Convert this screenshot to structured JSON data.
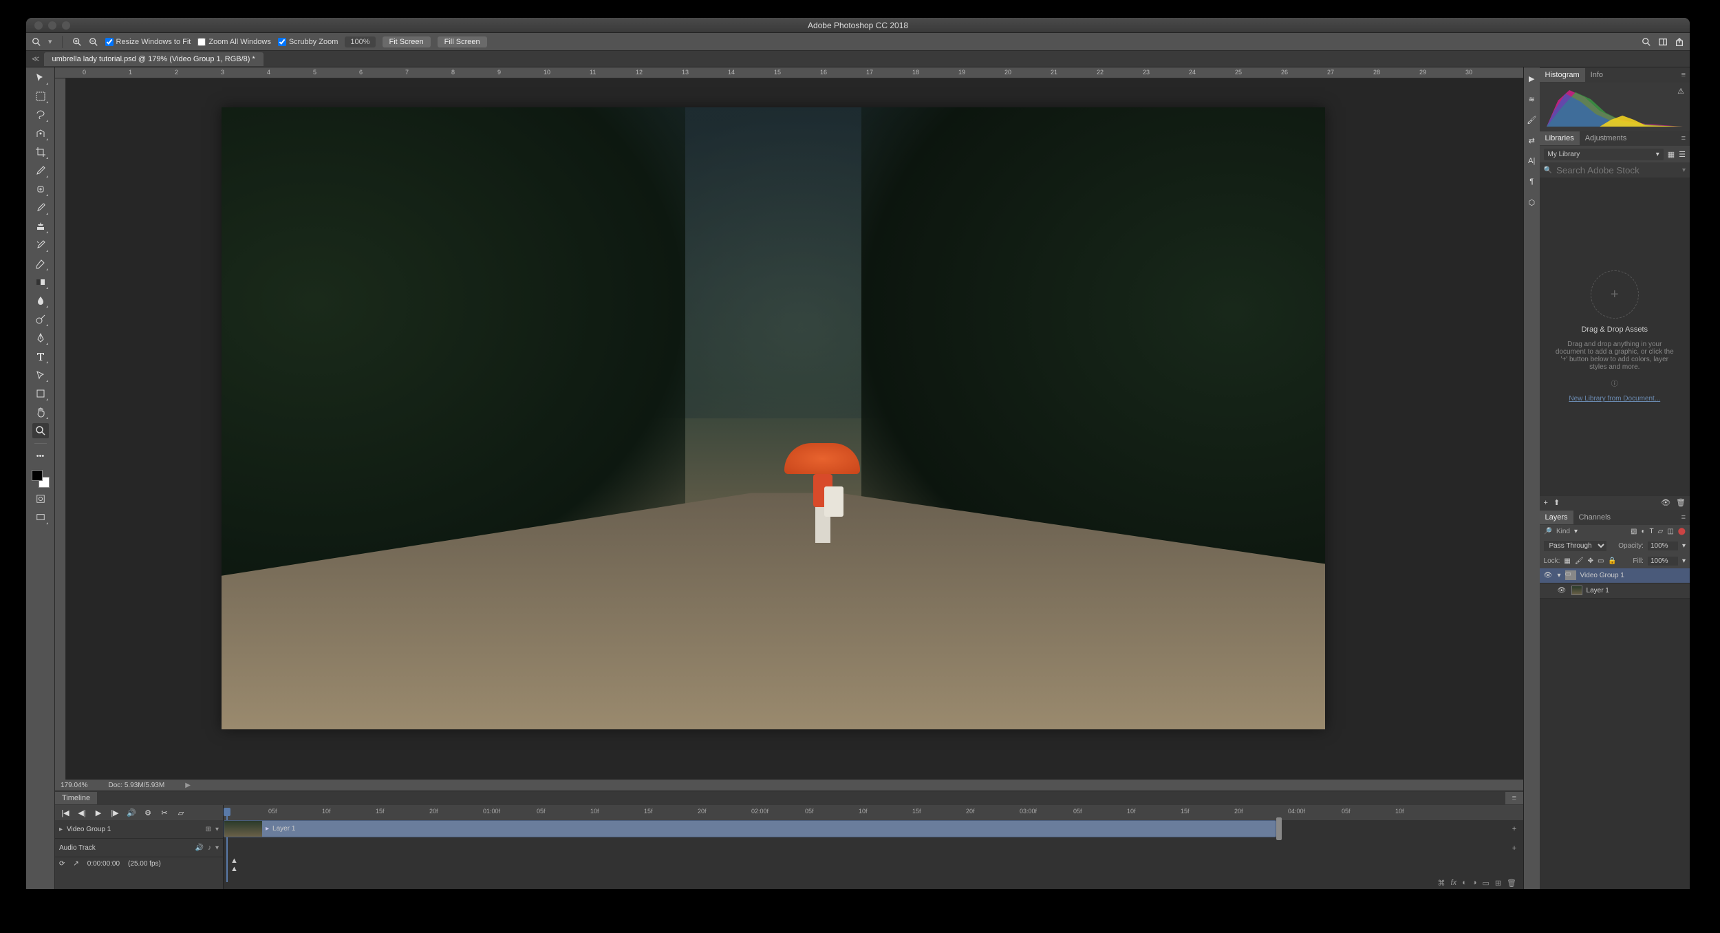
{
  "app": {
    "title": "Adobe Photoshop CC 2018"
  },
  "toolbar": {
    "resize_windows": "Resize Windows to Fit",
    "zoom_all": "Zoom All Windows",
    "scrubby": "Scrubby Zoom",
    "zoom_value": "100%",
    "fit_screen": "Fit Screen",
    "fill_screen": "Fill Screen"
  },
  "document": {
    "tab": "umbrella lady tutorial.psd @ 179% (Video Group 1, RGB/8) *"
  },
  "ruler": [
    "0",
    "1",
    "2",
    "3",
    "4",
    "5",
    "6",
    "7",
    "8",
    "9",
    "10",
    "11",
    "12",
    "13",
    "14",
    "15",
    "16",
    "17",
    "18",
    "19",
    "20",
    "21",
    "22",
    "23",
    "24",
    "25",
    "26",
    "27",
    "28",
    "29",
    "30"
  ],
  "status": {
    "zoom": "179.04%",
    "doc": "Doc: 5.93M/5.93M"
  },
  "timeline": {
    "tab": "Timeline",
    "ticks": [
      "05f",
      "10f",
      "15f",
      "20f",
      "01:00f",
      "05f",
      "10f",
      "15f",
      "20f",
      "02:00f",
      "05f",
      "10f",
      "15f",
      "20f",
      "03:00f",
      "05f",
      "10f",
      "15f",
      "20f",
      "04:00f",
      "05f",
      "10f"
    ],
    "video_group": "Video Group 1",
    "audio_track": "Audio Track",
    "clip_label": "Layer 1",
    "timecode": "0:00:00:00",
    "fps": "(25.00 fps)"
  },
  "panels": {
    "histogram_tab": "Histogram",
    "info_tab": "Info",
    "libraries_tab": "Libraries",
    "adjustments_tab": "Adjustments",
    "my_library": "My Library",
    "search_placeholder": "Search Adobe Stock",
    "drag_title": "Drag & Drop Assets",
    "drag_body": "Drag and drop anything in your document to add a graphic, or click the '+' button below to add colors, layer styles and more.",
    "new_library": "New Library from Document...",
    "layers_tab": "Layers",
    "channels_tab": "Channels",
    "kind": "Kind",
    "blend_mode": "Pass Through",
    "opacity_label": "Opacity:",
    "opacity_val": "100%",
    "lock_label": "Lock:",
    "fill_label": "Fill:",
    "fill_val": "100%",
    "layer_group": "Video Group 1",
    "layer_1": "Layer 1"
  }
}
